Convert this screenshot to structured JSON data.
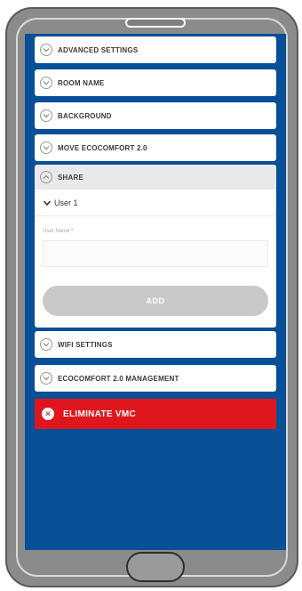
{
  "settings_menu": {
    "items": [
      {
        "label": "ADVANCED SETTINGS",
        "icon": "chevron-down-circle-icon"
      },
      {
        "label": "ROOM NAME",
        "icon": "chevron-down-circle-icon"
      },
      {
        "label": "BACKGROUND",
        "icon": "chevron-down-circle-icon"
      },
      {
        "label": "MOVE ECOCOMFORT 2.0",
        "icon": "chevron-down-circle-icon"
      }
    ],
    "share": {
      "label": "SHARE",
      "icon": "chevron-up-circle-icon",
      "user": "User 1",
      "user_name_label": "User Name *",
      "user_name_value": "",
      "add_label": "ADD"
    },
    "items_after": [
      {
        "label": "WIFI SETTINGS",
        "icon": "chevron-down-circle-icon"
      },
      {
        "label": "ECOCOMFORT 2.0 MANAGEMENT",
        "icon": "chevron-down-circle-icon"
      }
    ],
    "eliminate": {
      "label": "ELIMINATE VMC",
      "icon": "close-circle-icon"
    }
  },
  "colors": {
    "screen_background": "#074f96",
    "danger": "#e0161e",
    "button_disabled": "#c9c9c9",
    "device_frame": "#8b8b8b"
  }
}
